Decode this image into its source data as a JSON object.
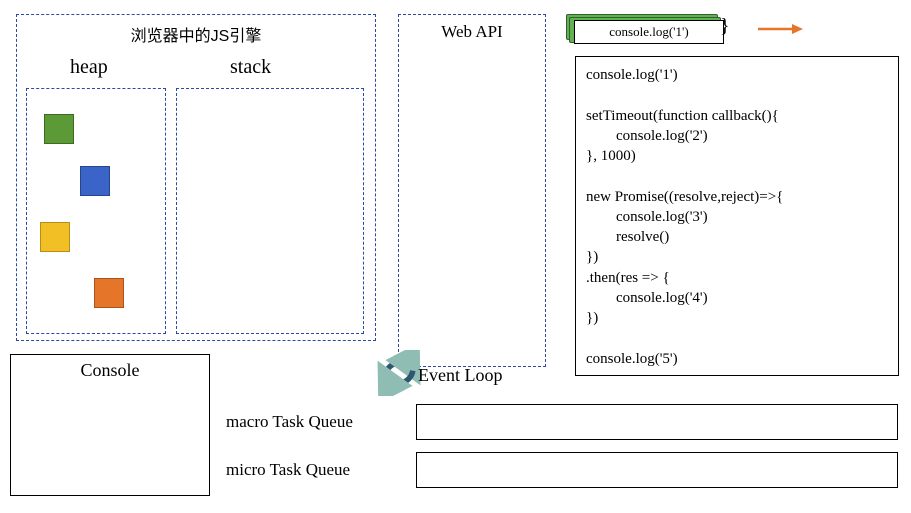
{
  "engine": {
    "title": "浏览器中的JS引擎",
    "heap_label": "heap",
    "stack_label": "stack"
  },
  "webapi": {
    "title": "Web API"
  },
  "console": {
    "title": "Console"
  },
  "eventloop": {
    "label": "Event Loop"
  },
  "queues": {
    "macro_label": "macro Task Queue",
    "micro_label": "micro Task Queue"
  },
  "current_chip": {
    "text": "console.log('1')",
    "brace": "}"
  },
  "code": "console.log('1')\n\nsetTimeout(function callback(){\n        console.log('2')\n}, 1000)\n\nnew Promise((resolve,reject)=>{\n        console.log('3')\n        resolve()\n})\n.then(res => {\n        console.log('4')\n})\n\nconsole.log('5')",
  "heap_blocks": [
    "green",
    "blue",
    "yellow",
    "orange"
  ],
  "arrow_color": "#e57629"
}
